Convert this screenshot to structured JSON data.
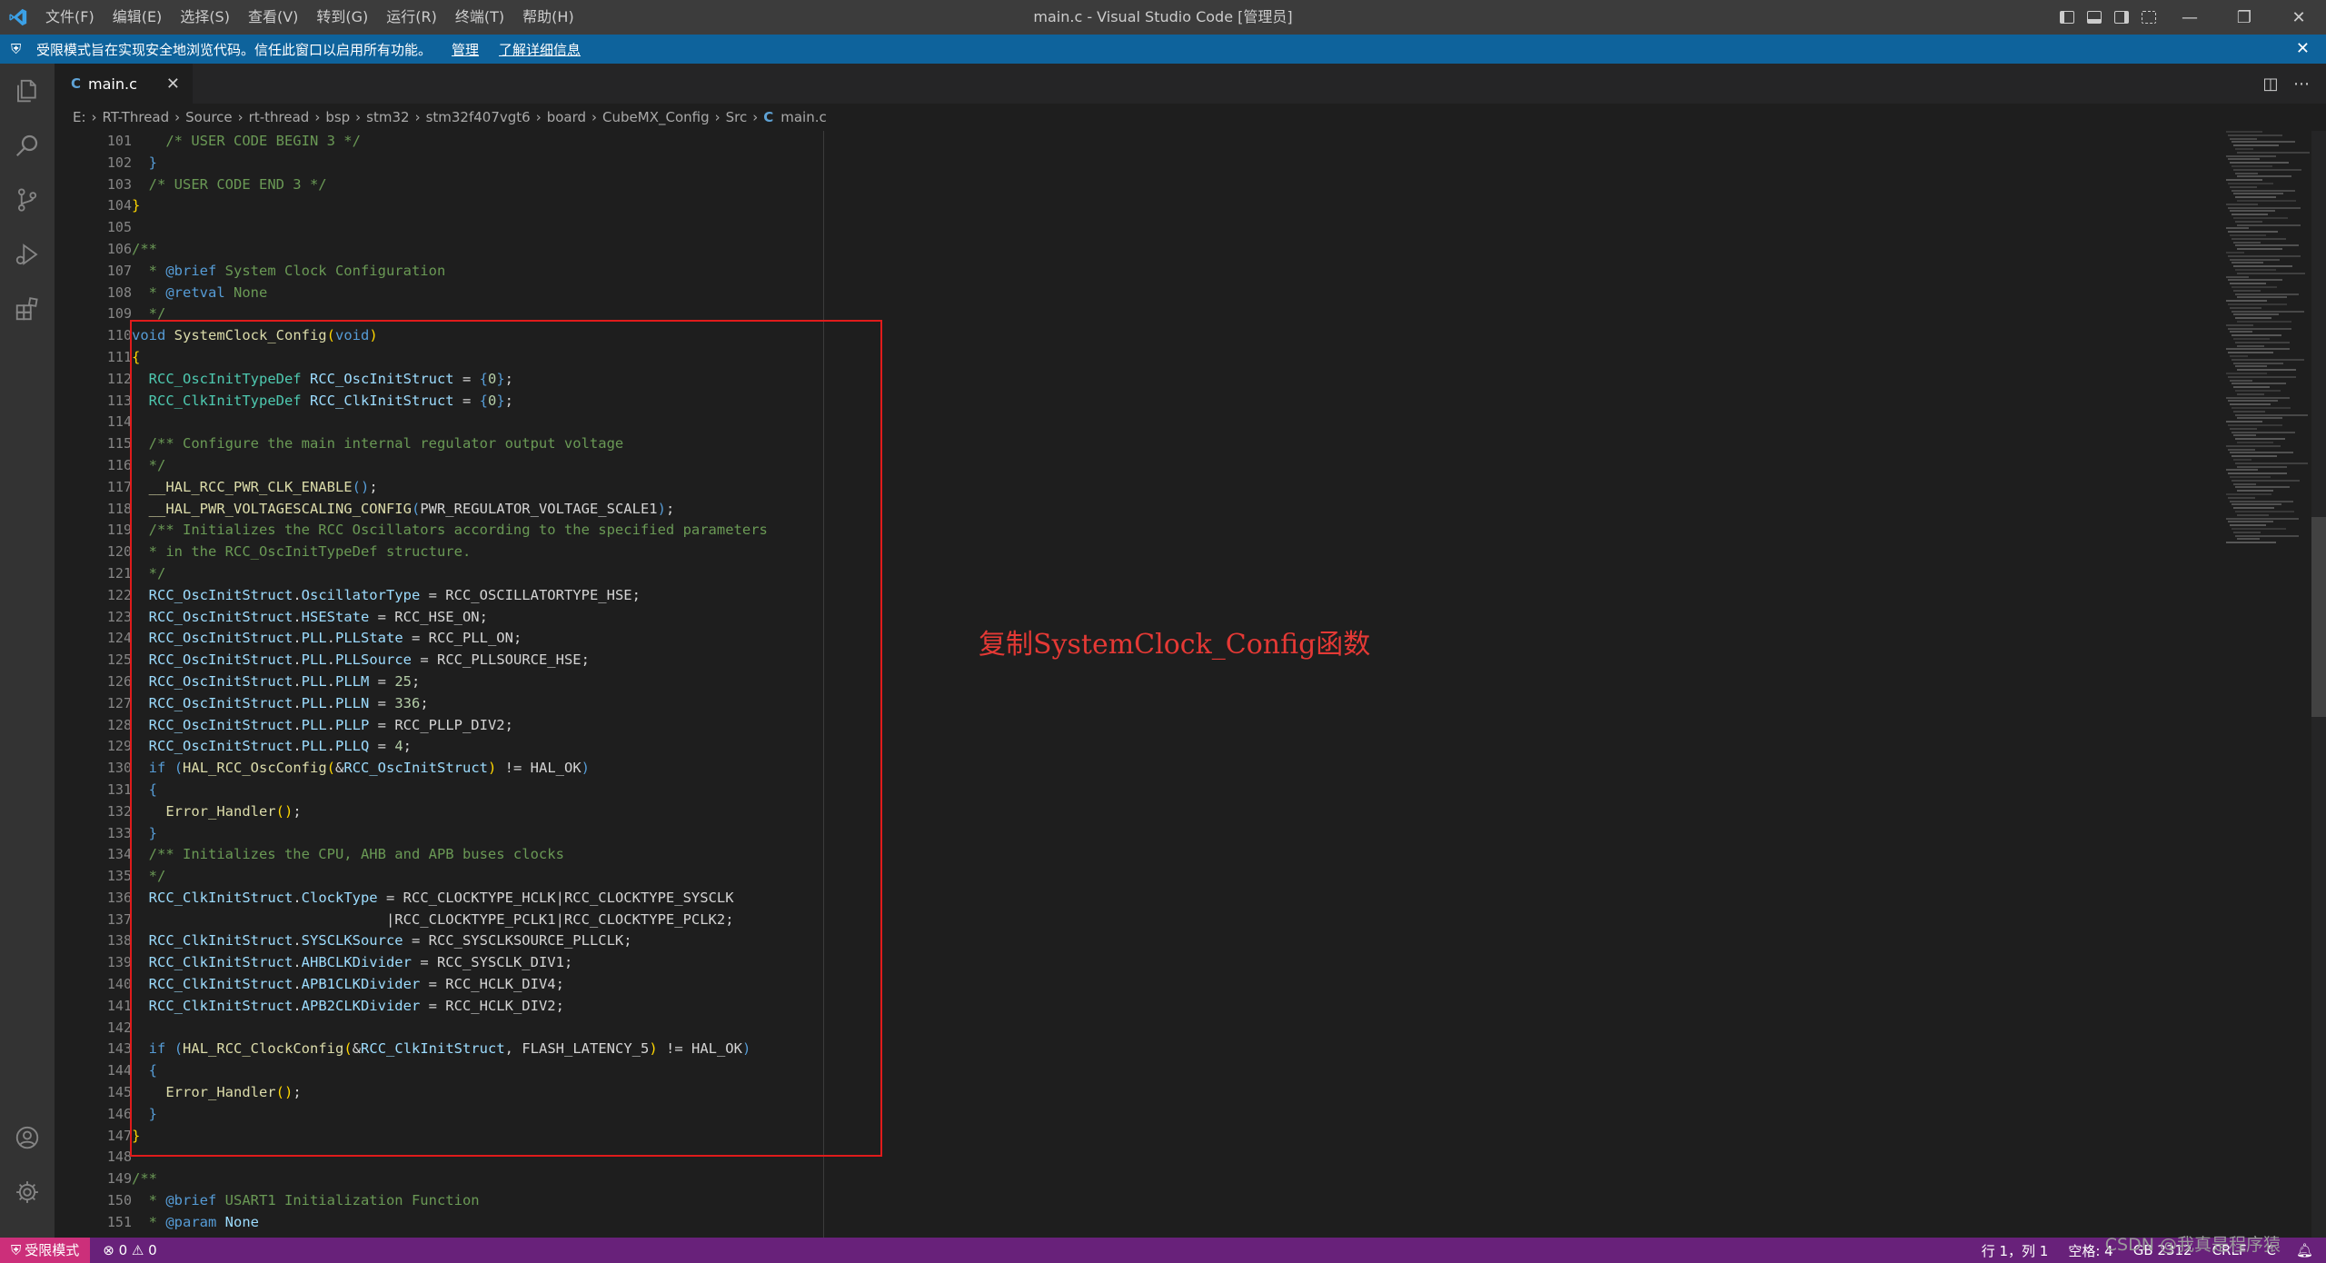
{
  "app": {
    "window_title": "main.c - Visual Studio Code [管理员]",
    "menu": [
      "文件(F)",
      "编辑(E)",
      "选择(S)",
      "查看(V)",
      "转到(G)",
      "运行(R)",
      "终端(T)",
      "帮助(H)"
    ]
  },
  "banner": {
    "message": "受限模式旨在实现安全地浏览代码。信任此窗口以启用所有功能。",
    "manage": "管理",
    "learn_more": "了解详细信息",
    "color": "#0e639c"
  },
  "tab": {
    "file_icon": "C",
    "label": "main.c"
  },
  "breadcrumb": [
    "E:",
    "RT-Thread",
    "Source",
    "rt-thread",
    "bsp",
    "stm32",
    "stm32f407vgt6",
    "board",
    "CubeMX_Config",
    "Src"
  ],
  "breadcrumb_file": "main.c",
  "editor": {
    "line_numbers": [
      "101",
      "102",
      "103",
      "104",
      "105",
      "106",
      "107",
      "108",
      "109",
      "110",
      "111",
      "112",
      "113",
      "114",
      "115",
      "116",
      "117",
      "118",
      "119",
      "120",
      "121",
      "122",
      "123",
      "124",
      "125",
      "126",
      "127",
      "128",
      "129",
      "130",
      "131",
      "132",
      "133",
      "134",
      "135",
      "136",
      "137",
      "138",
      "139",
      "140",
      "141",
      "142",
      "143",
      "144",
      "145",
      "146",
      "147",
      "148",
      "149",
      "150",
      "151"
    ],
    "annotation": "复制SystemClock_Config函数",
    "highlight_color": "#e01b1b"
  },
  "status": {
    "restricted": "受限模式",
    "problems": "⊗ 0 ⚠ 0",
    "position": "行 1，列 1",
    "spaces": "空格: 4",
    "encoding": "GB 2312",
    "eol": "CRLF",
    "language": "C",
    "color": "#68217a"
  },
  "watermark": "CSDN @我真是程序猿"
}
